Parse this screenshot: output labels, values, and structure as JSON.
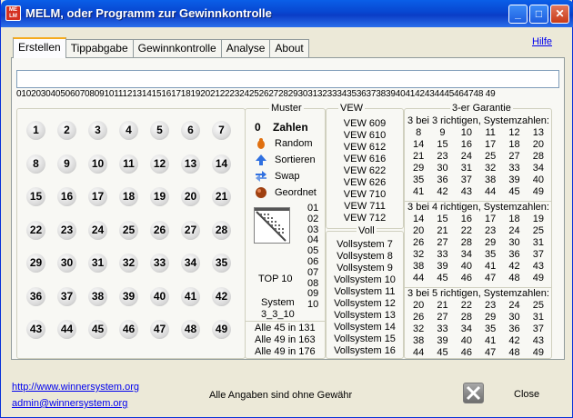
{
  "window": {
    "title": "MELM, oder Programm zur Gewinnkontrolle",
    "icon_text": "ME\nLM"
  },
  "tabs": [
    "Erstellen",
    "Tippabgabe",
    "Gewinnkontrolle",
    "Analyse",
    "About"
  ],
  "help_label": "Hilfe",
  "input_value": "",
  "number_strip": "010203040506070809101112131415161718192021222324252627282930313233343536373839404142434445464748 49",
  "balls": [
    "1",
    "2",
    "3",
    "4",
    "5",
    "6",
    "7",
    "8",
    "9",
    "10",
    "11",
    "12",
    "13",
    "14",
    "15",
    "16",
    "17",
    "18",
    "19",
    "20",
    "21",
    "22",
    "23",
    "24",
    "25",
    "26",
    "27",
    "28",
    "29",
    "30",
    "31",
    "32",
    "33",
    "34",
    "35",
    "36",
    "37",
    "38",
    "39",
    "40",
    "41",
    "42",
    "43",
    "44",
    "45",
    "46",
    "47",
    "48",
    "49"
  ],
  "muster": {
    "label": "Muster",
    "count": "0",
    "zahlen_label": "Zahlen",
    "random": "Random",
    "sortieren": "Sortieren",
    "swap": "Swap",
    "geordnet": "Geordnet",
    "list": [
      "01",
      "02",
      "03",
      "04",
      "05",
      "06",
      "07",
      "08",
      "09",
      "10"
    ],
    "top": "TOP 10",
    "system": "System",
    "system_val": "3_3_10",
    "alle": [
      "Alle 45 in 131",
      "Alle 49 in 163",
      "Alle 49 in 176"
    ]
  },
  "vew": {
    "label": "VEW",
    "items": [
      "VEW 609",
      "VEW 610",
      "VEW 612",
      "VEW 616",
      "VEW 622",
      "VEW 626",
      "VEW 710",
      "VEW 711",
      "VEW 712"
    ]
  },
  "voll": {
    "label": "Voll",
    "items": [
      "Vollsystem  7",
      "Vollsystem  8",
      "Vollsystem  9",
      "Vollsystem 10",
      "Vollsystem 11",
      "Vollsystem 12",
      "Vollsystem 13",
      "Vollsystem 14",
      "Vollsystem 15",
      "Vollsystem 16"
    ]
  },
  "garantie": {
    "label": "3-er Garantie",
    "g1_title": "3 bei 3 richtigen, Systemzahlen:",
    "g1": [
      [
        "8",
        "9",
        "10",
        "11",
        "12",
        "13"
      ],
      [
        "14",
        "15",
        "16",
        "17",
        "18",
        "20"
      ],
      [
        "21",
        "23",
        "24",
        "25",
        "27",
        "28"
      ],
      [
        "29",
        "30",
        "31",
        "32",
        "33",
        "34"
      ],
      [
        "35",
        "36",
        "37",
        "38",
        "39",
        "40"
      ],
      [
        "41",
        "42",
        "43",
        "44",
        "45",
        "49"
      ]
    ],
    "g2_title": "3 bei 4 richtigen, Systemzahlen:",
    "g2": [
      [
        "14",
        "15",
        "16",
        "17",
        "18",
        "19"
      ],
      [
        "20",
        "21",
        "22",
        "23",
        "24",
        "25"
      ],
      [
        "26",
        "27",
        "28",
        "29",
        "30",
        "31"
      ],
      [
        "32",
        "33",
        "34",
        "35",
        "36",
        "37"
      ],
      [
        "38",
        "39",
        "40",
        "41",
        "42",
        "43"
      ],
      [
        "44",
        "45",
        "46",
        "47",
        "48",
        "49"
      ]
    ],
    "g3_title": "3 bei 5 richtigen, Systemzahlen:",
    "g3": [
      [
        "20",
        "21",
        "22",
        "23",
        "24",
        "25"
      ],
      [
        "26",
        "27",
        "28",
        "29",
        "30",
        "31"
      ],
      [
        "32",
        "33",
        "34",
        "35",
        "36",
        "37"
      ],
      [
        "38",
        "39",
        "40",
        "41",
        "42",
        "43"
      ],
      [
        "44",
        "45",
        "46",
        "47",
        "48",
        "49"
      ]
    ]
  },
  "footer": {
    "url": "http://www.winnersystem.org",
    "email": "admin@winnersystem.org",
    "disclaimer": "Alle Angaben sind ohne Gewähr",
    "close": "Close"
  }
}
